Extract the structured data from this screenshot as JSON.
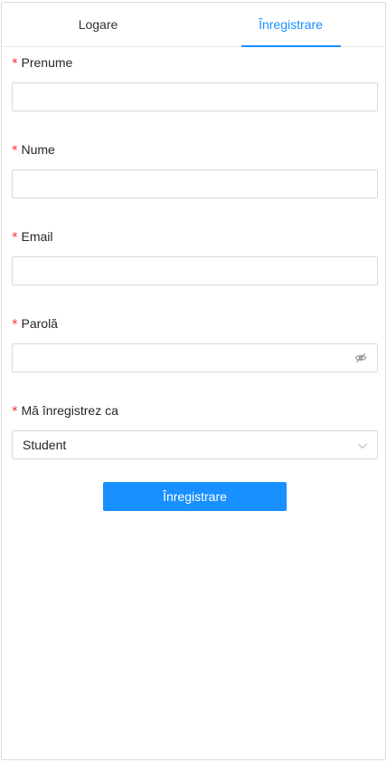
{
  "tabs": {
    "login": "Logare",
    "register": "Înregistrare",
    "active": "register"
  },
  "form": {
    "required_mark": "*",
    "fields": [
      {
        "label": "Prenume",
        "value": ""
      },
      {
        "label": "Nume",
        "value": ""
      },
      {
        "label": "Email",
        "value": ""
      },
      {
        "label": "Parolă",
        "value": ""
      }
    ],
    "role": {
      "label": "Mă înregistrez ca",
      "selected": "Student"
    },
    "submit_label": "Înregistrare"
  },
  "colors": {
    "accent": "#1890ff",
    "required": "#f5222d",
    "border": "#d9d9d9"
  },
  "icons": {
    "password_toggle": "eye-invisible-icon",
    "select_arrow": "chevron-down-icon"
  }
}
